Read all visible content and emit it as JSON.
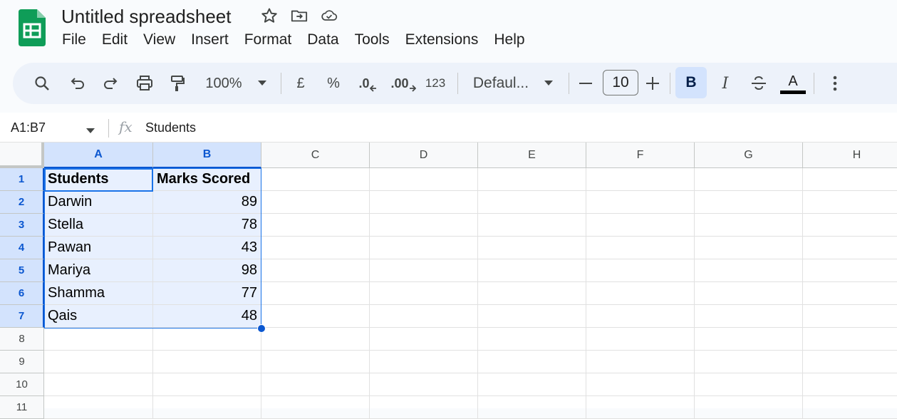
{
  "app": {
    "title": "Untitled spreadsheet",
    "icons": [
      "star-icon",
      "move-to-folder-icon",
      "cloud-saved-icon"
    ]
  },
  "menu": [
    "File",
    "Edit",
    "View",
    "Insert",
    "Format",
    "Data",
    "Tools",
    "Extensions",
    "Help"
  ],
  "toolbar": {
    "zoom": "100%",
    "currency": "£",
    "percent": "%",
    "decrease_decimal": ".0",
    "increase_decimal": ".00",
    "number_format": "123",
    "font": "Defaul...",
    "font_size": "10",
    "bold": "B",
    "italic": "I",
    "text_color_letter": "A"
  },
  "formula_bar": {
    "name_box": "A1:B7",
    "fx": "fx",
    "value": "Students"
  },
  "columns": [
    "A",
    "B",
    "C",
    "D",
    "E",
    "F",
    "G",
    "H"
  ],
  "rows": [
    "1",
    "2",
    "3",
    "4",
    "5",
    "6",
    "7",
    "8",
    "9",
    "10",
    "11"
  ],
  "table": {
    "header": [
      "Students",
      "Marks Scored"
    ],
    "data": [
      [
        "Darwin",
        "89"
      ],
      [
        "Stella",
        "78"
      ],
      [
        "Pawan",
        "43"
      ],
      [
        "Mariya",
        "98"
      ],
      [
        "Shamma",
        "77"
      ],
      [
        "Qais",
        "48"
      ]
    ]
  },
  "colors": {
    "accent": "#0b57d0",
    "selection_fill": "#e8f0fe",
    "header_selected": "#d3e3fd",
    "logo_green": "#0f9d58"
  }
}
